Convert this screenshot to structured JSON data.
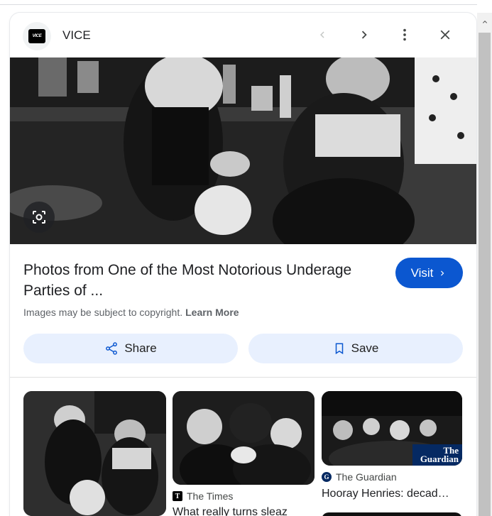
{
  "header": {
    "site_name": "VICE",
    "logo_text": "VICE",
    "icons": [
      "chevron-left-icon",
      "chevron-right-icon",
      "more-vert-icon",
      "close-icon"
    ]
  },
  "main_image": {
    "alt_icon": "lens-icon"
  },
  "result": {
    "title": "Photos from One of the Most Notorious Underage Parties of ...",
    "visit_label": "Visit",
    "copyright_text": "Images may be subject to copyright.",
    "learn_more": "Learn More"
  },
  "actions": {
    "share_label": "Share",
    "save_label": "Save"
  },
  "related": [
    {
      "source": "The Times",
      "title": "What really turns sleaz"
    },
    {
      "source": "The Guardian",
      "title": "Hooray Henries: decad…",
      "badge": "The Guardian"
    }
  ],
  "colors": {
    "accent": "#0b57d0",
    "button_bg": "#e8f0fe"
  }
}
